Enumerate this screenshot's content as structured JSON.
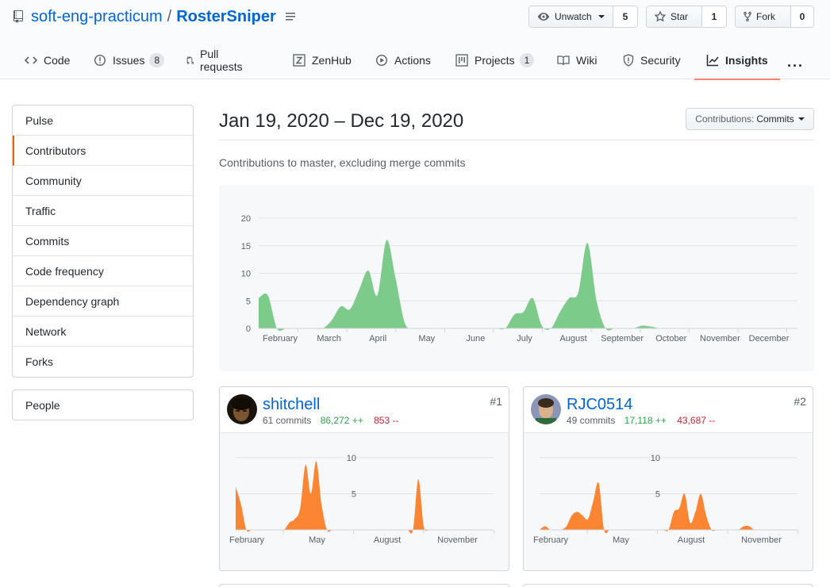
{
  "repo": {
    "owner": "soft-eng-practicum",
    "separator": "/",
    "name": "RosterSniper"
  },
  "actions": {
    "watch": {
      "label": "Unwatch",
      "count": "5"
    },
    "star": {
      "label": "Star",
      "count": "1"
    },
    "fork": {
      "label": "Fork",
      "count": "0"
    }
  },
  "tabs": [
    {
      "label": "Code",
      "icon": "code-icon"
    },
    {
      "label": "Issues",
      "icon": "issue-icon",
      "counter": "8"
    },
    {
      "label": "Pull requests",
      "icon": "pull-request-icon"
    },
    {
      "label": "ZenHub",
      "icon": "zenhub-icon"
    },
    {
      "label": "Actions",
      "icon": "play-icon"
    },
    {
      "label": "Projects",
      "icon": "project-icon",
      "counter": "1"
    },
    {
      "label": "Wiki",
      "icon": "book-icon"
    },
    {
      "label": "Security",
      "icon": "shield-icon"
    },
    {
      "label": "Insights",
      "icon": "graph-icon",
      "selected": true
    }
  ],
  "sidebar": {
    "items": [
      "Pulse",
      "Contributors",
      "Community",
      "Traffic",
      "Commits",
      "Code frequency",
      "Dependency graph",
      "Network",
      "Forks"
    ],
    "selected": "Contributors",
    "people": "People"
  },
  "main": {
    "date_range": "Jan 19, 2020 – Dec 19, 2020",
    "contributions_label": "Contributions:",
    "contributions_value": "Commits",
    "subtitle": "Contributions to master, excluding merge commits"
  },
  "colors": {
    "accent": "#f9826c",
    "main_area": "#7dcb8b",
    "contributor_area": "#fb8532",
    "link": "#0366d6"
  },
  "chart_data": [
    {
      "type": "area",
      "series": [
        {
          "values": [
            5.5,
            6.0,
            0,
            0,
            0,
            0,
            0,
            0,
            1.5,
            4,
            3.5,
            7,
            10.5,
            6,
            16,
            9,
            1,
            0,
            0,
            0,
            0,
            0,
            0,
            0,
            0,
            0,
            0,
            0,
            2.5,
            3,
            5.5,
            0.5,
            0,
            3,
            5.5,
            6.5,
            15.5,
            5,
            0,
            0,
            0,
            0,
            0.5,
            0.3,
            0,
            0,
            0,
            0,
            0,
            0,
            0,
            0,
            0,
            0,
            0,
            0,
            0,
            0,
            0,
            0
          ]
        }
      ],
      "x_labels": [
        "February",
        "March",
        "April",
        "May",
        "June",
        "July",
        "August",
        "September",
        "October",
        "November",
        "December"
      ],
      "y_ticks": [
        0,
        5,
        10,
        15,
        20
      ],
      "ylim": [
        0,
        20
      ]
    },
    {
      "type": "area",
      "series": [
        {
          "values": [
            6,
            3.5,
            0,
            0,
            0,
            0,
            0,
            0,
            0,
            0,
            1,
            1.5,
            3,
            9,
            5,
            9.5,
            3.5,
            0,
            0,
            0,
            0,
            0,
            0,
            0,
            0,
            0,
            0,
            0,
            0,
            0,
            0,
            0,
            0,
            0,
            7,
            0.5,
            0,
            0,
            0,
            0,
            0,
            0,
            0,
            0,
            0,
            0,
            0,
            0,
            0
          ]
        }
      ],
      "x_labels": [
        "February",
        "May",
        "August",
        "November"
      ],
      "y_ticks": [
        5,
        10
      ],
      "ylim": [
        0,
        11.2
      ]
    },
    {
      "type": "area",
      "series": [
        {
          "values": [
            0,
            0.5,
            0,
            0,
            0,
            0.5,
            2,
            2.5,
            2,
            1.5,
            4,
            6.5,
            0,
            0,
            0,
            0,
            0,
            0,
            0,
            0,
            0,
            0,
            0,
            0,
            0,
            2.5,
            3,
            5,
            1,
            2.5,
            5,
            2,
            0,
            0,
            0,
            0,
            0,
            0,
            0.5,
            0.5,
            0,
            0,
            0,
            0,
            0,
            0,
            0,
            0,
            0
          ]
        }
      ],
      "x_labels": [
        "February",
        "May",
        "August",
        "November"
      ],
      "y_ticks": [
        5,
        10
      ],
      "ylim": [
        0,
        11.2
      ]
    }
  ],
  "contributors": [
    {
      "name": "shitchell",
      "commits": "61 commits",
      "additions": "86,272 ++",
      "deletions": "853 --",
      "rank": "#1"
    },
    {
      "name": "RJC0514",
      "commits": "49 commits",
      "additions": "17,118 ++",
      "deletions": "43,687 --",
      "rank": "#2"
    }
  ]
}
